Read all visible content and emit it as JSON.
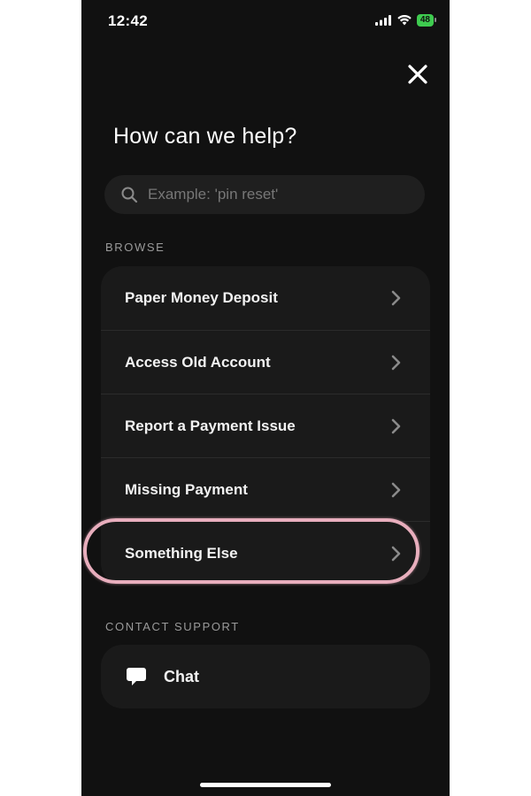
{
  "status_bar": {
    "time": "12:42",
    "battery": "48"
  },
  "header": {
    "title": "How can we help?"
  },
  "search": {
    "placeholder": "Example: 'pin reset'"
  },
  "browse": {
    "label": "BROWSE",
    "items": [
      {
        "label": "Paper Money Deposit"
      },
      {
        "label": "Access Old Account"
      },
      {
        "label": "Report a Payment Issue"
      },
      {
        "label": "Missing Payment"
      },
      {
        "label": "Something Else"
      }
    ]
  },
  "contact": {
    "label": "CONTACT SUPPORT",
    "chat_label": "Chat"
  },
  "colors": {
    "background": "#111111",
    "card": "#1a1a1a",
    "highlight": "#e8aebd",
    "battery": "#3ecb4f"
  },
  "icons": [
    "signal-icon",
    "wifi-icon",
    "battery-icon",
    "close-icon",
    "search-icon",
    "chevron-right-icon",
    "chat-bubble-icon"
  ]
}
